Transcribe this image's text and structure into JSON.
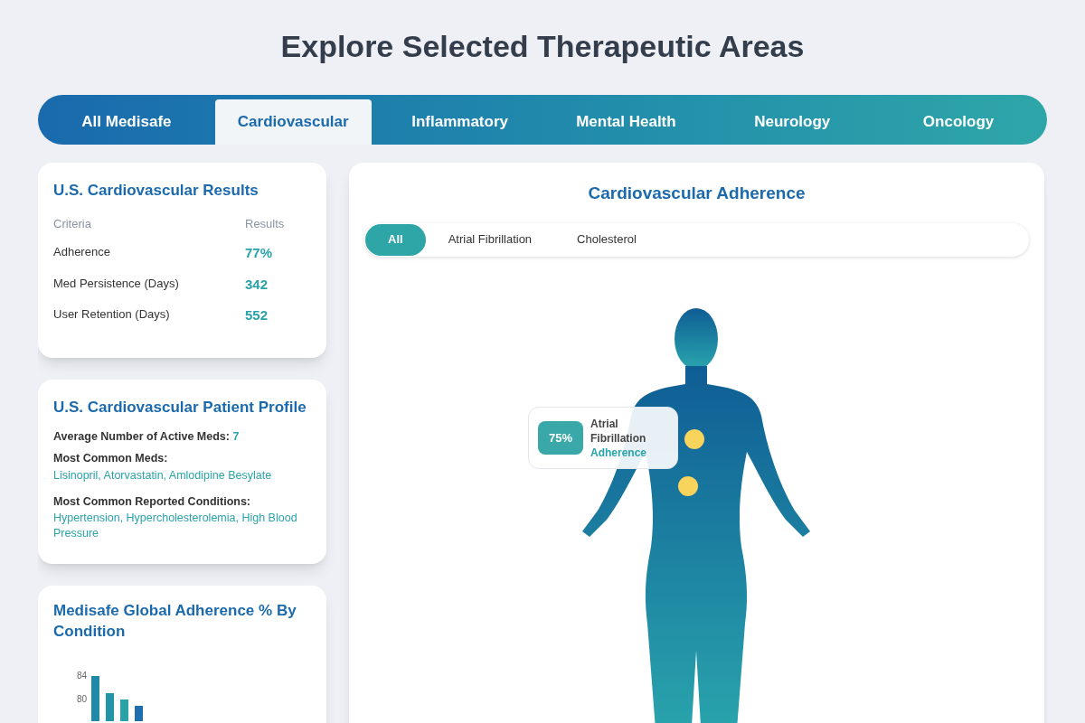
{
  "title": "Explore Selected Therapeutic Areas",
  "tabs": [
    {
      "label": "All Medisafe",
      "selected": false
    },
    {
      "label": "Cardiovascular",
      "selected": true
    },
    {
      "label": "Inflammatory",
      "selected": false
    },
    {
      "label": "Mental Health",
      "selected": false
    },
    {
      "label": "Neurology",
      "selected": false
    },
    {
      "label": "Oncology",
      "selected": false
    }
  ],
  "results": {
    "title": "U.S. Cardiovascular Results",
    "columns": [
      "Criteria",
      "Results"
    ],
    "rows": [
      {
        "criteria": "Adherence",
        "result": "77%"
      },
      {
        "criteria": "Med Persistence (Days)",
        "result": "342"
      },
      {
        "criteria": "User Retention (Days)",
        "result": "552"
      }
    ]
  },
  "profile": {
    "title": "U.S. Cardiovascular Patient Profile",
    "average": "Average Number of Active Meds: **7**",
    "meds_label": "Most Common Meds:",
    "meds": "Lisinopril, Atorvastatin, Amlodipine Besylate",
    "conditions_label": "Most Common Reported Conditions:",
    "conditions": "Hypertension, Hypercholesterolemia, High Blood Pressure"
  },
  "global": {
    "title": "Medisafe Global Adherence % By Condition",
    "axis_labels": [
      "84",
      "80"
    ]
  },
  "adherence": {
    "title": "Cardiovascular Adherence",
    "filters": [
      {
        "label": "All",
        "selected": true
      },
      {
        "label": "Atrial Fibrillation",
        "selected": false
      },
      {
        "label": "Cholesterol",
        "selected": false
      }
    ],
    "tooltip": {
      "value": "75%",
      "name": "Atrial Fibrillation",
      "metric": "Adherence"
    }
  }
}
